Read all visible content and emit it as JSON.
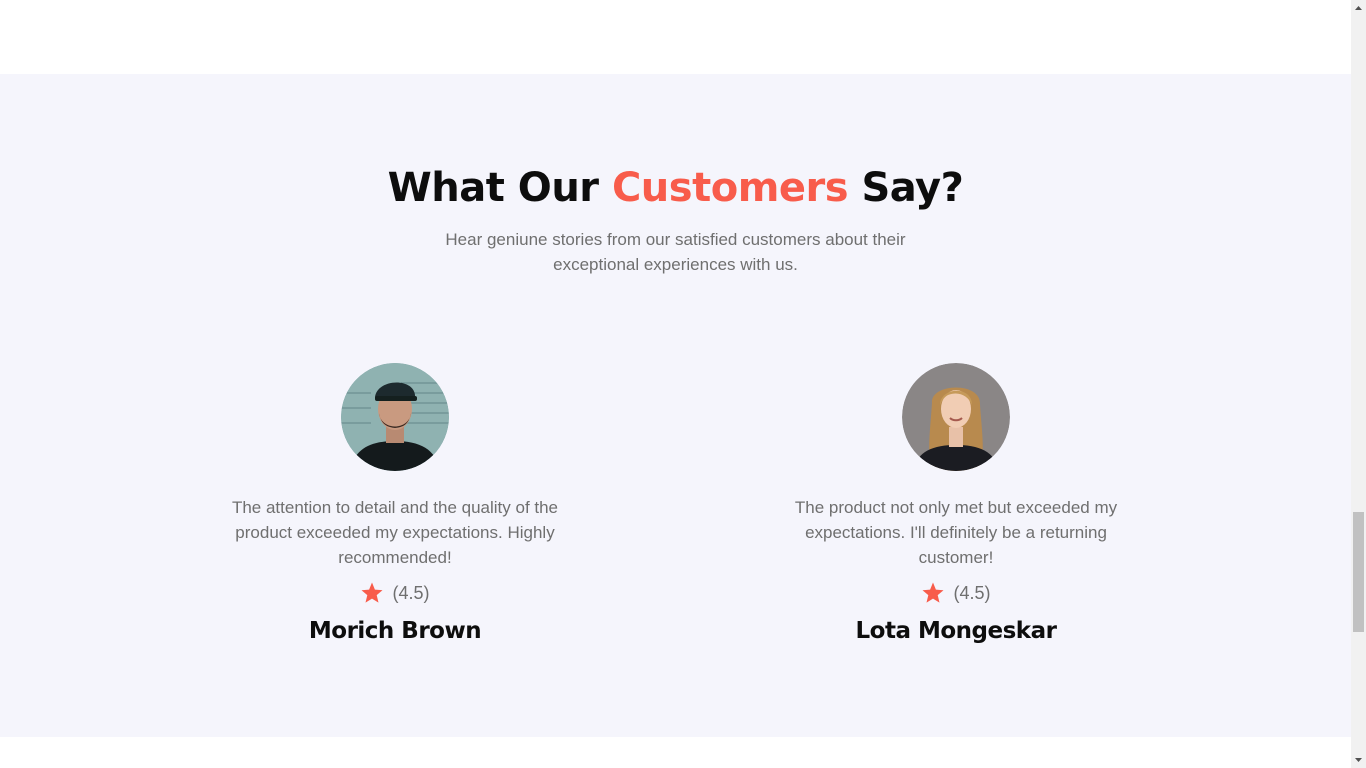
{
  "testimonials_section": {
    "heading_part1": "What Our ",
    "heading_accent": "Customers",
    "heading_part2": " Say?",
    "subtitle": "Hear geniune stories from our satisfied customers about their exceptional experiences with us.",
    "accent_color": "#f85c4b",
    "testimonials": [
      {
        "quote": "The attention to detail and the quality of the product exceeded my expectations. Highly recommended!",
        "rating": "(4.5)",
        "name": "Morich Brown",
        "avatar_icon": "man-avatar-icon"
      },
      {
        "quote": "The product not only met but exceeded my expectations. I'll definitely be a returning customer!",
        "rating": "(4.5)",
        "name": "Lota Mongeskar",
        "avatar_icon": "woman-avatar-icon"
      }
    ]
  }
}
